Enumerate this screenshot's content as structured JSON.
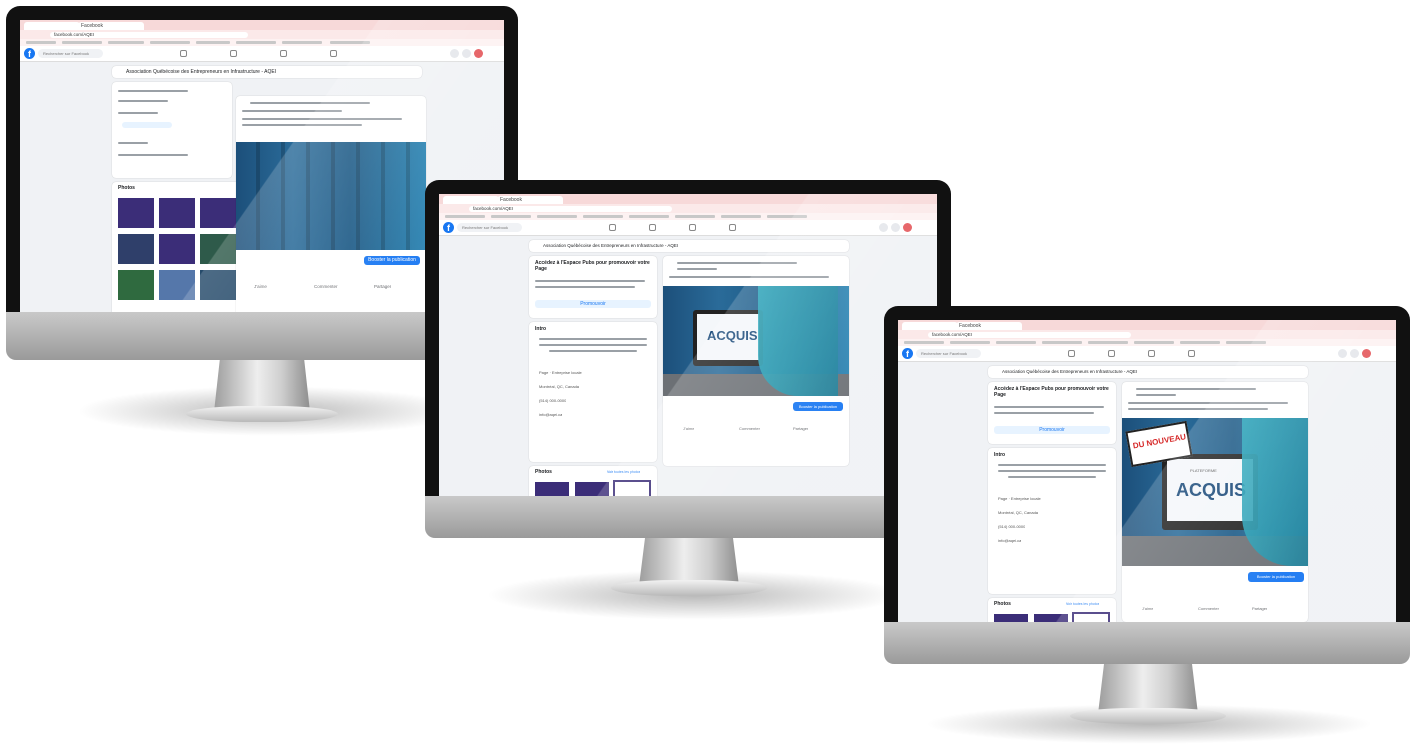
{
  "browser": {
    "tab_active": "Facebook",
    "url": "facebook.com/AQEI"
  },
  "facebook": {
    "search_placeholder": "Rechercher sur Facebook",
    "page_name": "Association Québécoise des Entrepreneurs en Infrastructure - AQEI",
    "promo_title": "Accédez à l'Espace Pubs pour promouvoir votre Page",
    "promo_button": "Promouvoir",
    "intro_heading": "Intro",
    "about_items": [
      "Page · Entreprise locale",
      "Montréal, QC, Canada",
      "(514) 000-0000",
      "info@aqei.ca"
    ],
    "photos_heading": "Photos",
    "see_all_photos": "Voir toutes les photos",
    "post_actions": [
      "J'aime",
      "Commenter",
      "Partager"
    ],
    "boost_button": "Booster la publication"
  },
  "artwork": {
    "platform_name": "PLATEFORME",
    "brand": "ACQUIS",
    "sticker": "DU NOUVEAU"
  },
  "colors": {
    "facebook_blue": "#1877f2",
    "curtain_blue": "#1e5b8a",
    "photo_purple": "#3b2d78"
  }
}
